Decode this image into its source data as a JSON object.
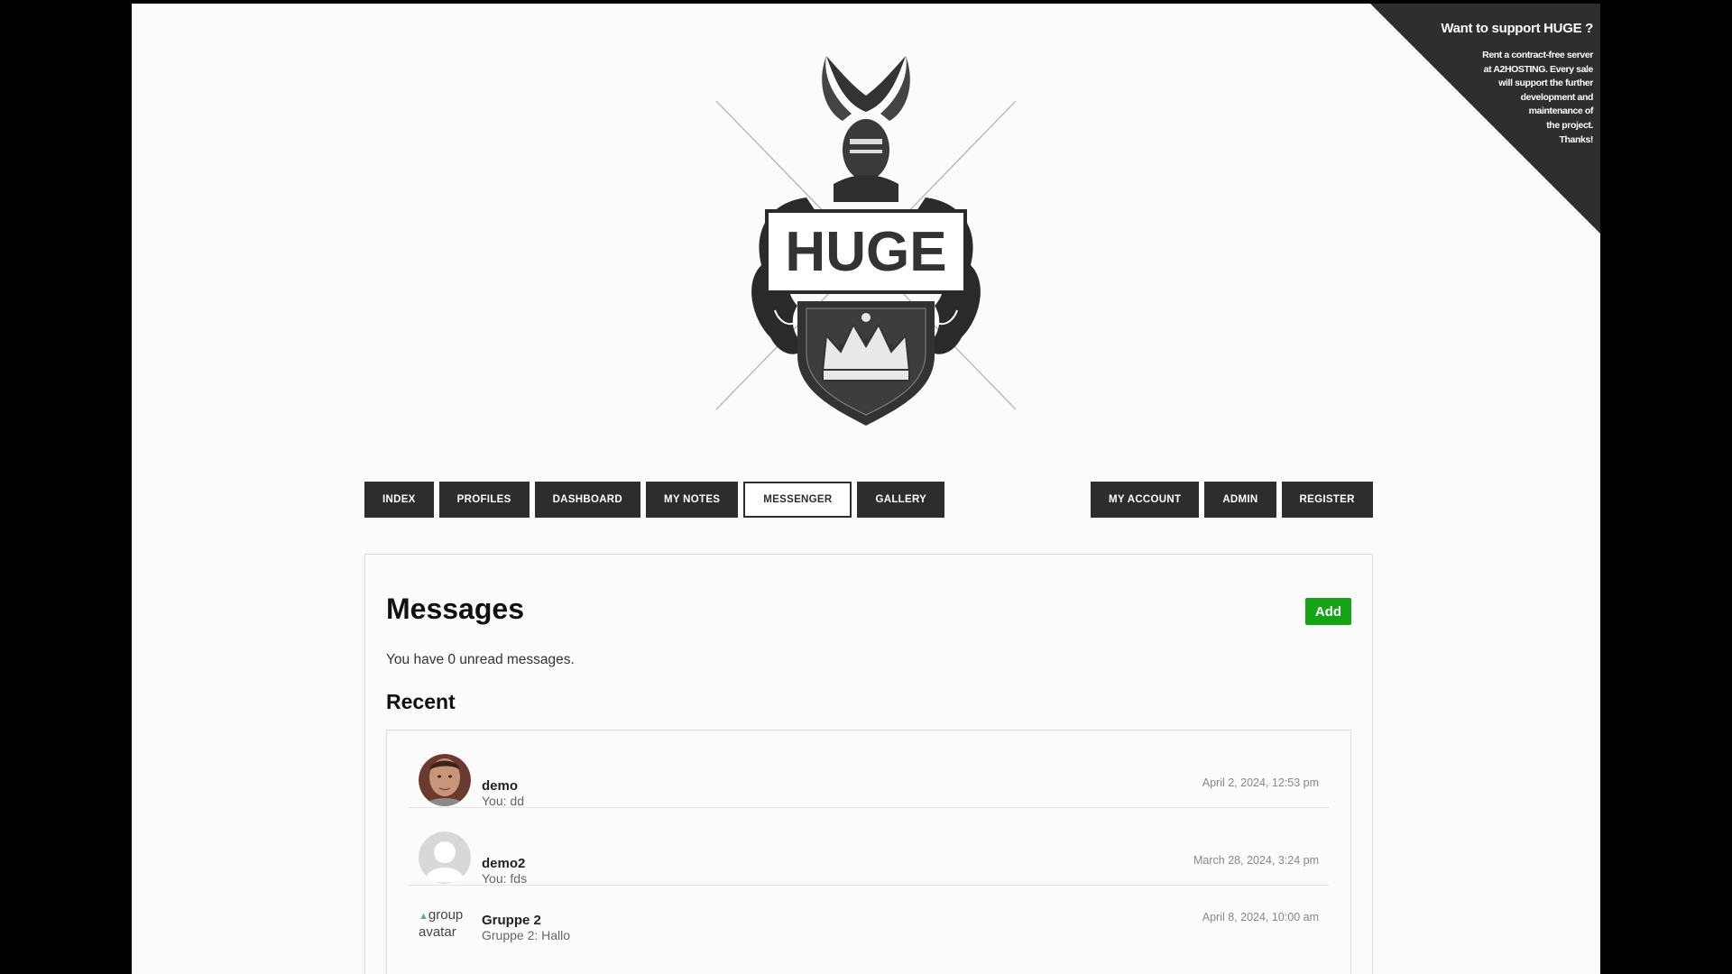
{
  "corner": {
    "title": "Want to support HUGE ?",
    "lines": [
      "Rent a contract-free server",
      "at A2HOSTING. Every sale",
      "will support the further",
      "development and",
      "maintenance of",
      "the project.",
      "Thanks!"
    ]
  },
  "logo": {
    "text": "HUGE"
  },
  "nav": {
    "left": [
      "INDEX",
      "PROFILES",
      "DASHBOARD",
      "MY NOTES",
      "MESSENGER",
      "GALLERY"
    ],
    "right": [
      "MY ACCOUNT",
      "ADMIN",
      "REGISTER"
    ],
    "active": "MESSENGER"
  },
  "messages": {
    "title": "Messages",
    "add_label": "Add",
    "unread_text": "You have 0 unread messages.",
    "recent_title": "Recent",
    "conversations": [
      {
        "name": "demo",
        "preview": "You: dd",
        "date": "April 2, 2024, 12:53 pm",
        "avatar": "photo"
      },
      {
        "name": "demo2",
        "preview": "You: fds",
        "date": "March 28, 2024, 3:24 pm",
        "avatar": "default"
      },
      {
        "name": "Gruppe 2",
        "preview": "Gruppe 2: Hallo",
        "date": "April 8, 2024, 10:00 am",
        "avatar": "broken",
        "avatar_alt_lines": [
          "group",
          "avatar"
        ]
      }
    ]
  },
  "colors": {
    "accent_green": "#17a317",
    "nav_dark": "#2d2d2d",
    "corner_dark": "#2e2e2e"
  }
}
